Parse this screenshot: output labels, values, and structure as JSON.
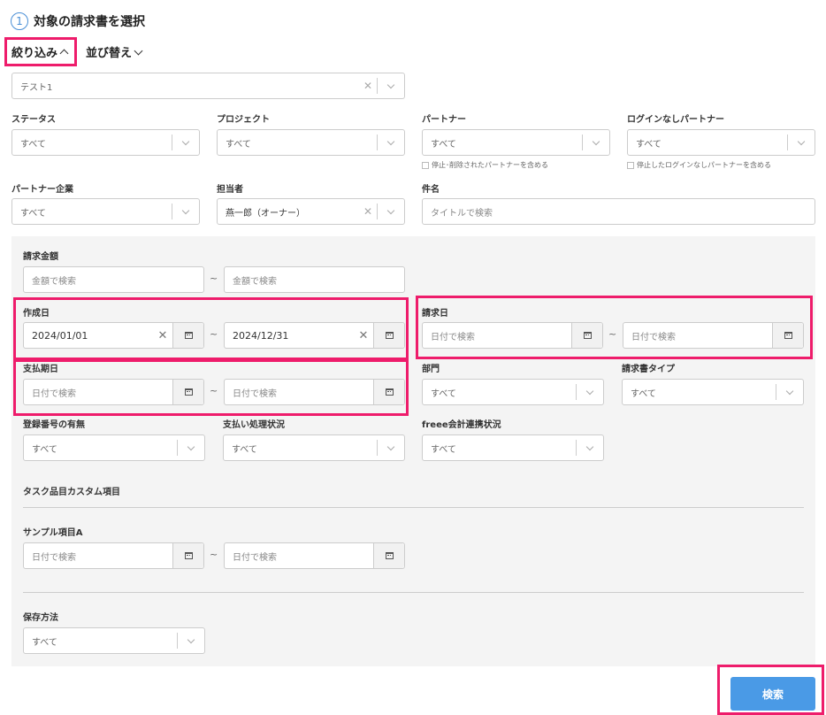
{
  "header": {
    "step": "1",
    "title": "対象の請求書を選択"
  },
  "tabs": {
    "filter": "絞り込み",
    "sort": "並び替え"
  },
  "top_filter": {
    "value": "テスト1"
  },
  "status": {
    "label": "ステータス",
    "value": "すべて"
  },
  "project": {
    "label": "プロジェクト",
    "value": "すべて"
  },
  "partner": {
    "label": "パートナー",
    "value": "すべて",
    "note": "停止･削除されたパートナーを含める"
  },
  "nologin_partner": {
    "label": "ログインなしパートナー",
    "value": "すべて",
    "note": "停止したログインなしパートナーを含める"
  },
  "partner_company": {
    "label": "パートナー企業",
    "value": "すべて"
  },
  "assignee": {
    "label": "担当者",
    "value": "燕一郎（オーナー）"
  },
  "subject": {
    "label": "件名",
    "placeholder": "タイトルで検索"
  },
  "amount": {
    "label": "請求金額",
    "from_placeholder": "金額で検索",
    "to_placeholder": "金額で検索"
  },
  "created_date": {
    "label": "作成日",
    "from": "2024/01/01",
    "to": "2024/12/31"
  },
  "invoice_date": {
    "label": "請求日",
    "from_placeholder": "日付で検索",
    "to_placeholder": "日付で検索"
  },
  "due_date": {
    "label": "支払期日",
    "from_placeholder": "日付で検索",
    "to_placeholder": "日付で検索"
  },
  "department": {
    "label": "部門",
    "value": "すべて"
  },
  "invoice_type": {
    "label": "請求書タイプ",
    "value": "すべて"
  },
  "registration": {
    "label": "登録番号の有無",
    "value": "すべて"
  },
  "payment_status": {
    "label": "支払い処理状況",
    "value": "すべて"
  },
  "freee": {
    "label": "freee会計連携状況",
    "value": "すべて"
  },
  "custom_section": {
    "label": "タスク品目カスタム項目"
  },
  "sample_a": {
    "label": "サンプル項目A",
    "from_placeholder": "日付で検索",
    "to_placeholder": "日付で検索"
  },
  "storage": {
    "label": "保存方法",
    "value": "すべて"
  },
  "tilde": "~",
  "search_button": "検索"
}
